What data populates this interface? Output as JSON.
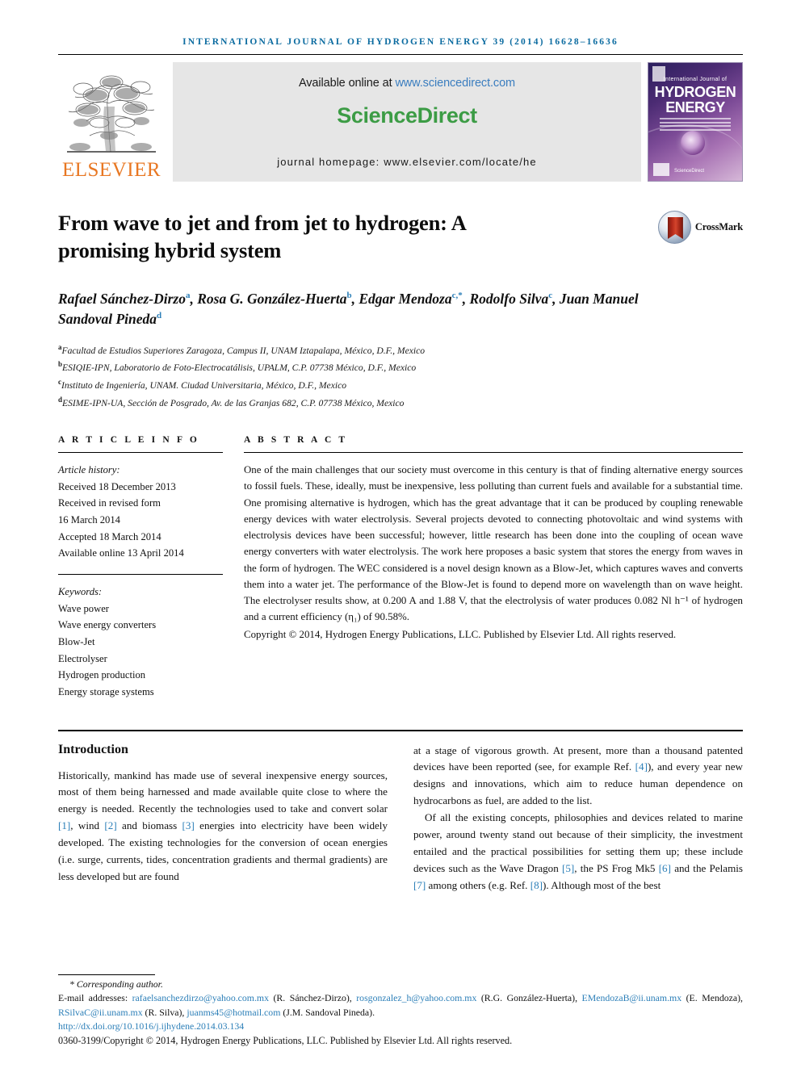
{
  "running_head": "International Journal of Hydrogen Energy 39 (2014) 16628–16636",
  "masthead": {
    "elsevier_wordmark": "ELSEVIER",
    "available_prefix": "Available online at ",
    "available_link": "www.sciencedirect.com",
    "sciencedirect_logo": "ScienceDirect",
    "journal_homepage": "journal homepage: www.elsevier.com/locate/he",
    "cover": {
      "line1": "International Journal of",
      "line2": "HYDROGEN",
      "line3": "ENERGY",
      "publisher": "ScienceDirect"
    },
    "colors": {
      "link_blue": "#3a7dbf",
      "sciencedirect_green": "#3c9c45",
      "elsevier_orange": "#e87722",
      "banner_grey": "#e6e6e6",
      "running_head_blue": "#0b6ba0"
    }
  },
  "article": {
    "title": "From wave to jet and from jet to hydrogen: A promising hybrid system",
    "crossmark_label": "CrossMark",
    "authors_html": "Rafael Sánchez-Dirzo<sup>a</sup>, Rosa G. González-Huerta<sup>b</sup>, Edgar Mendoza<sup>c,*</sup>, Rodolfo Silva<sup>c</sup>, Juan Manuel Sandoval Pineda<sup>d</sup>",
    "affiliations": [
      {
        "marker": "a",
        "text": "Facultad de Estudios Superiores Zaragoza, Campus II, UNAM Iztapalapa, México, D.F., Mexico"
      },
      {
        "marker": "b",
        "text": "ESIQIE-IPN, Laboratorio de Foto-Electrocatálisis, UPALM, C.P. 07738 México, D.F., Mexico"
      },
      {
        "marker": "c",
        "text": "Instituto de Ingeniería, UNAM. Ciudad Universitaria, México, D.F., Mexico"
      },
      {
        "marker": "d",
        "text": "ESIME-IPN-UA, Sección de Posgrado, Av. de las Granjas 682, C.P. 07738 México, Mexico"
      }
    ]
  },
  "article_info": {
    "heading": "A R T I C L E    I N F O",
    "history_label": "Article history:",
    "history": [
      "Received 18 December 2013",
      "Received in revised form",
      "16 March 2014",
      "Accepted 18 March 2014",
      "Available online 13 April 2014"
    ],
    "keywords_label": "Keywords:",
    "keywords": [
      "Wave power",
      "Wave energy converters",
      "Blow-Jet",
      "Electrolyser",
      "Hydrogen production",
      "Energy storage systems"
    ]
  },
  "abstract": {
    "heading": "A B S T R A C T",
    "body": "One of the main challenges that our society must overcome in this century is that of finding alternative energy sources to fossil fuels. These, ideally, must be inexpensive, less polluting than current fuels and available for a substantial time. One promising alternative is hydrogen, which has the great advantage that it can be produced by coupling renewable energy devices with water electrolysis. Several projects devoted to connecting photovoltaic and wind systems with electrolysis devices have been successful; however, little research has been done into the coupling of ocean wave energy converters with water electrolysis. The work here proposes a basic system that stores the energy from waves in the form of hydrogen. The WEC considered is a novel design known as a Blow-Jet, which captures waves and converts them into a water jet. The performance of the Blow-Jet is found to depend more on wavelength than on wave height. The electrolyser results show, at 0.200 A and 1.88 V, that the electrolysis of water produces 0.082 Nl h⁻¹ of hydrogen and a current efficiency (η₁) of 90.58%.",
    "copyright": "Copyright © 2014, Hydrogen Energy Publications, LLC. Published by Elsevier Ltd. All rights reserved."
  },
  "introduction": {
    "heading": "Introduction",
    "left_paragraph_html": "Historically, mankind has made use of several inexpensive energy sources, most of them being harnessed and made available quite close to where the energy is needed. Recently the technologies used to take and convert solar <span class=\"ref\">[1]</span>, wind <span class=\"ref\">[2]</span> and biomass <span class=\"ref\">[3]</span> energies into electricity have been widely developed. The existing technologies for the conversion of ocean energies (i.e. surge, currents, tides, concentration gradients and thermal gradients) are less developed but are found",
    "right_paragraph_1_html": "at a stage of vigorous growth. At present, more than a thousand patented devices have been reported (see, for example Ref. <span class=\"ref\">[4]</span>), and every year new designs and innovations, which aim to reduce human dependence on hydrocarbons as fuel, are added to the list.",
    "right_paragraph_2_html": "Of all the existing concepts, philosophies and devices related to marine power, around twenty stand out because of their simplicity, the investment entailed and the practical possibilities for setting them up; these include devices such as the Wave Dragon <span class=\"ref\">[5]</span>, the PS Frog Mk5 <span class=\"ref\">[6]</span> and the Pelamis <span class=\"ref\">[7]</span> among others (e.g. Ref. <span class=\"ref\">[8]</span>). Although most of the best"
  },
  "footnote": {
    "corresponding": "* Corresponding author.",
    "emails_html": "E-mail addresses: <span class=\"mail\">rafaelsanchezdirzo@yahoo.com.mx</span> (R. Sánchez-Dirzo), <span class=\"mail\">rosgonzalez_h@yahoo.com.mx</span> (R.G. González-Huerta), <span class=\"mail\">EMendozaB@ii.unam.mx</span> (E. Mendoza), <span class=\"mail\">RSilvaC@ii.unam.mx</span> (R. Silva), <span class=\"mail\">juanms45@hotmail.com</span> (J.M. Sandoval Pineda).",
    "doi": "http://dx.doi.org/10.1016/j.ijhydene.2014.03.134",
    "issn_copyright": "0360-3199/Copyright © 2014, Hydrogen Energy Publications, LLC. Published by Elsevier Ltd. All rights reserved."
  }
}
